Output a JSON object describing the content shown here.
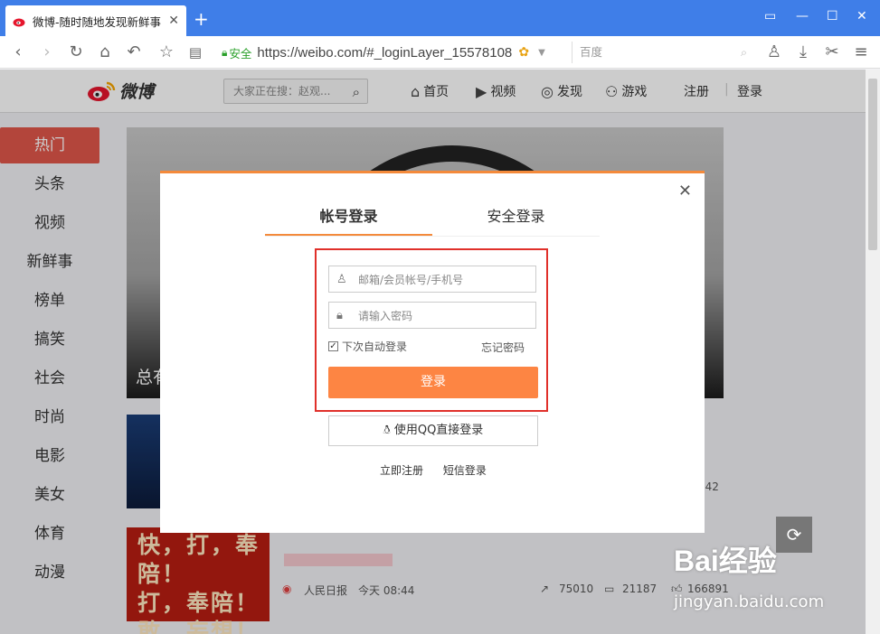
{
  "browser": {
    "tab_title": "微博-随时随地发现新鲜事",
    "secure_label": "安全",
    "url": "https://weibo.com/#_loginLayer_15578108",
    "search_engine": "百度"
  },
  "header": {
    "logo_text": "微博",
    "search_placeholder": "大家正在搜：赵观...",
    "nav": [
      "首页",
      "视频",
      "发现",
      "游戏"
    ],
    "register": "注册",
    "login": "登录"
  },
  "sidebar": {
    "items": [
      "热门",
      "头条",
      "视频",
      "新鲜事",
      "榜单",
      "搞笑",
      "社会",
      "时尚",
      "电影",
      "美女",
      "体育",
      "动漫"
    ]
  },
  "hero": {
    "caption": "总有"
  },
  "feed": {
    "row1_count": "942",
    "row2_source": "人民日报",
    "row2_time": "今天 08:44",
    "row2_share": "75010",
    "row2_comment": "21187",
    "row2_like": "166891",
    "row2_thumb_text": [
      "快，打，奉陪！",
      "打，奉陪！",
      "敢，妄想！"
    ]
  },
  "modal": {
    "tab_account": "帐号登录",
    "tab_secure": "安全登录",
    "username_placeholder": "邮箱/会员帐号/手机号",
    "password_placeholder": "请输入密码",
    "remember_label": "下次自动登录",
    "forgot_label": "忘记密码",
    "login_button": "登录",
    "qq_button": "使用QQ直接登录",
    "register_link": "立即注册",
    "sms_link": "短信登录"
  },
  "watermark": {
    "line1": "Bai经验",
    "line2": "jingyan.baidu.com"
  },
  "colors": {
    "accent": "#fd8543",
    "weibo_red": "#e0574a",
    "highlight_box": "#e0302a"
  }
}
